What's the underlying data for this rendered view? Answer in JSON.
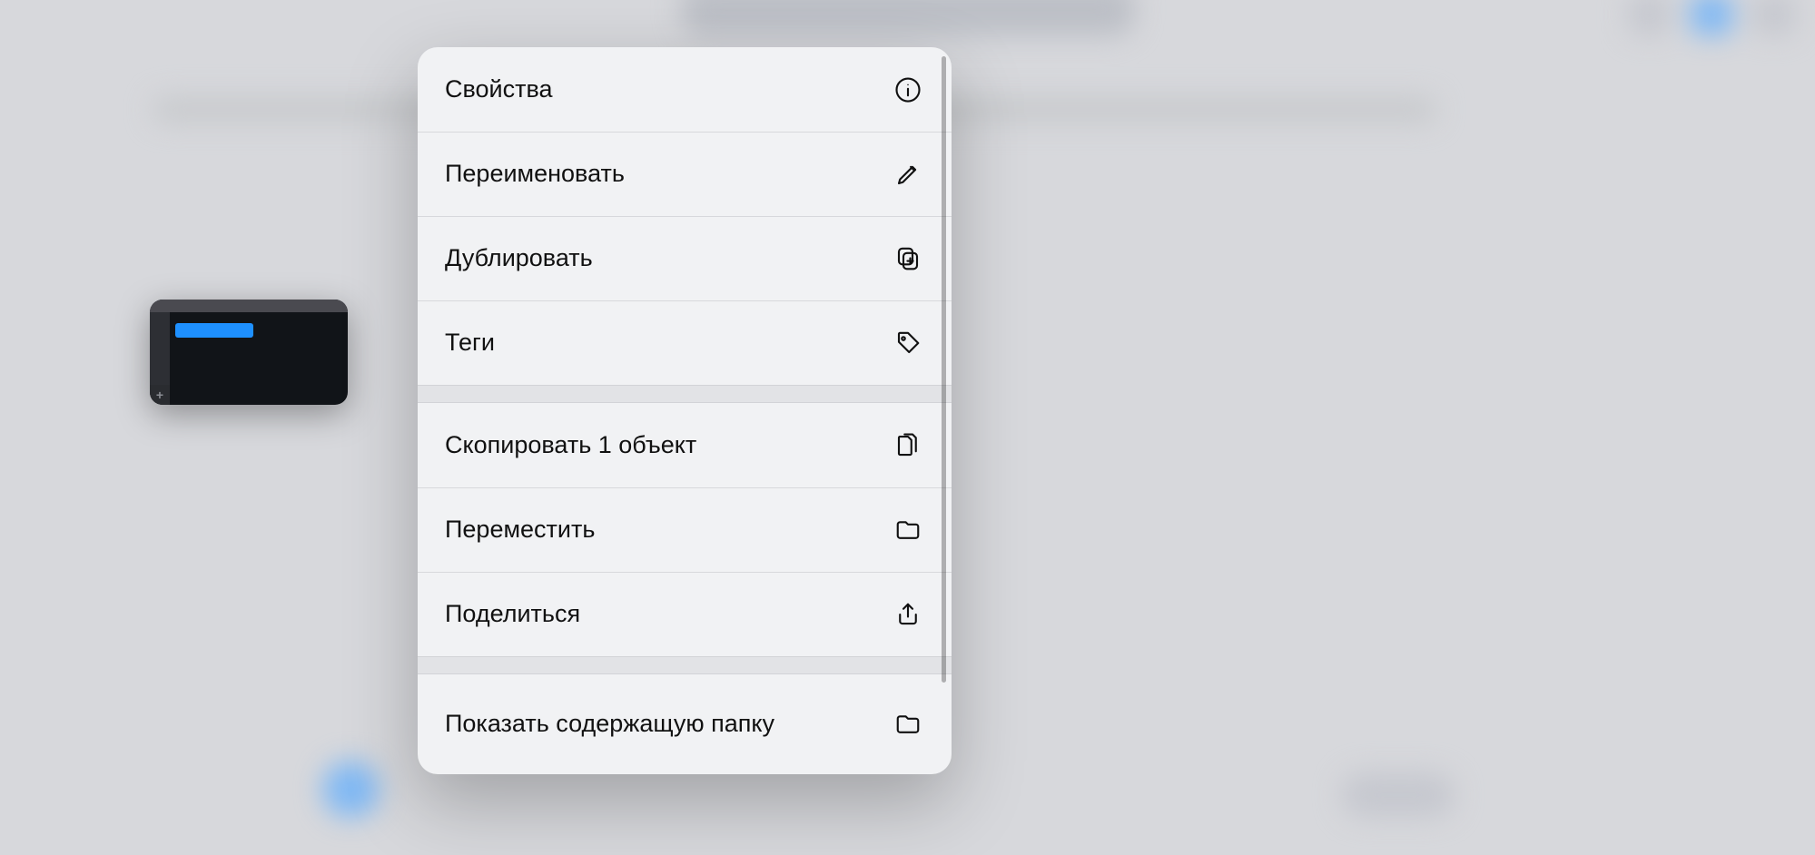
{
  "thumbnail": {
    "plus_glyph": "+"
  },
  "menu": {
    "groups": [
      {
        "items": [
          {
            "id": "info",
            "label": "Свойства",
            "icon": "info-icon"
          },
          {
            "id": "rename",
            "label": "Переименовать",
            "icon": "pencil-icon"
          },
          {
            "id": "duplicate",
            "label": "Дублировать",
            "icon": "copy-plus-icon"
          },
          {
            "id": "tags",
            "label": "Теги",
            "icon": "tag-icon"
          }
        ]
      },
      {
        "items": [
          {
            "id": "copy-one",
            "label": "Скопировать 1 объект",
            "icon": "two-pages-icon"
          },
          {
            "id": "move",
            "label": "Переместить",
            "icon": "folder-icon"
          },
          {
            "id": "share",
            "label": "Поделиться",
            "icon": "share-icon"
          }
        ]
      },
      {
        "items": [
          {
            "id": "reveal",
            "label": "Показать содержащую папку",
            "icon": "folder-icon"
          }
        ]
      }
    ]
  }
}
